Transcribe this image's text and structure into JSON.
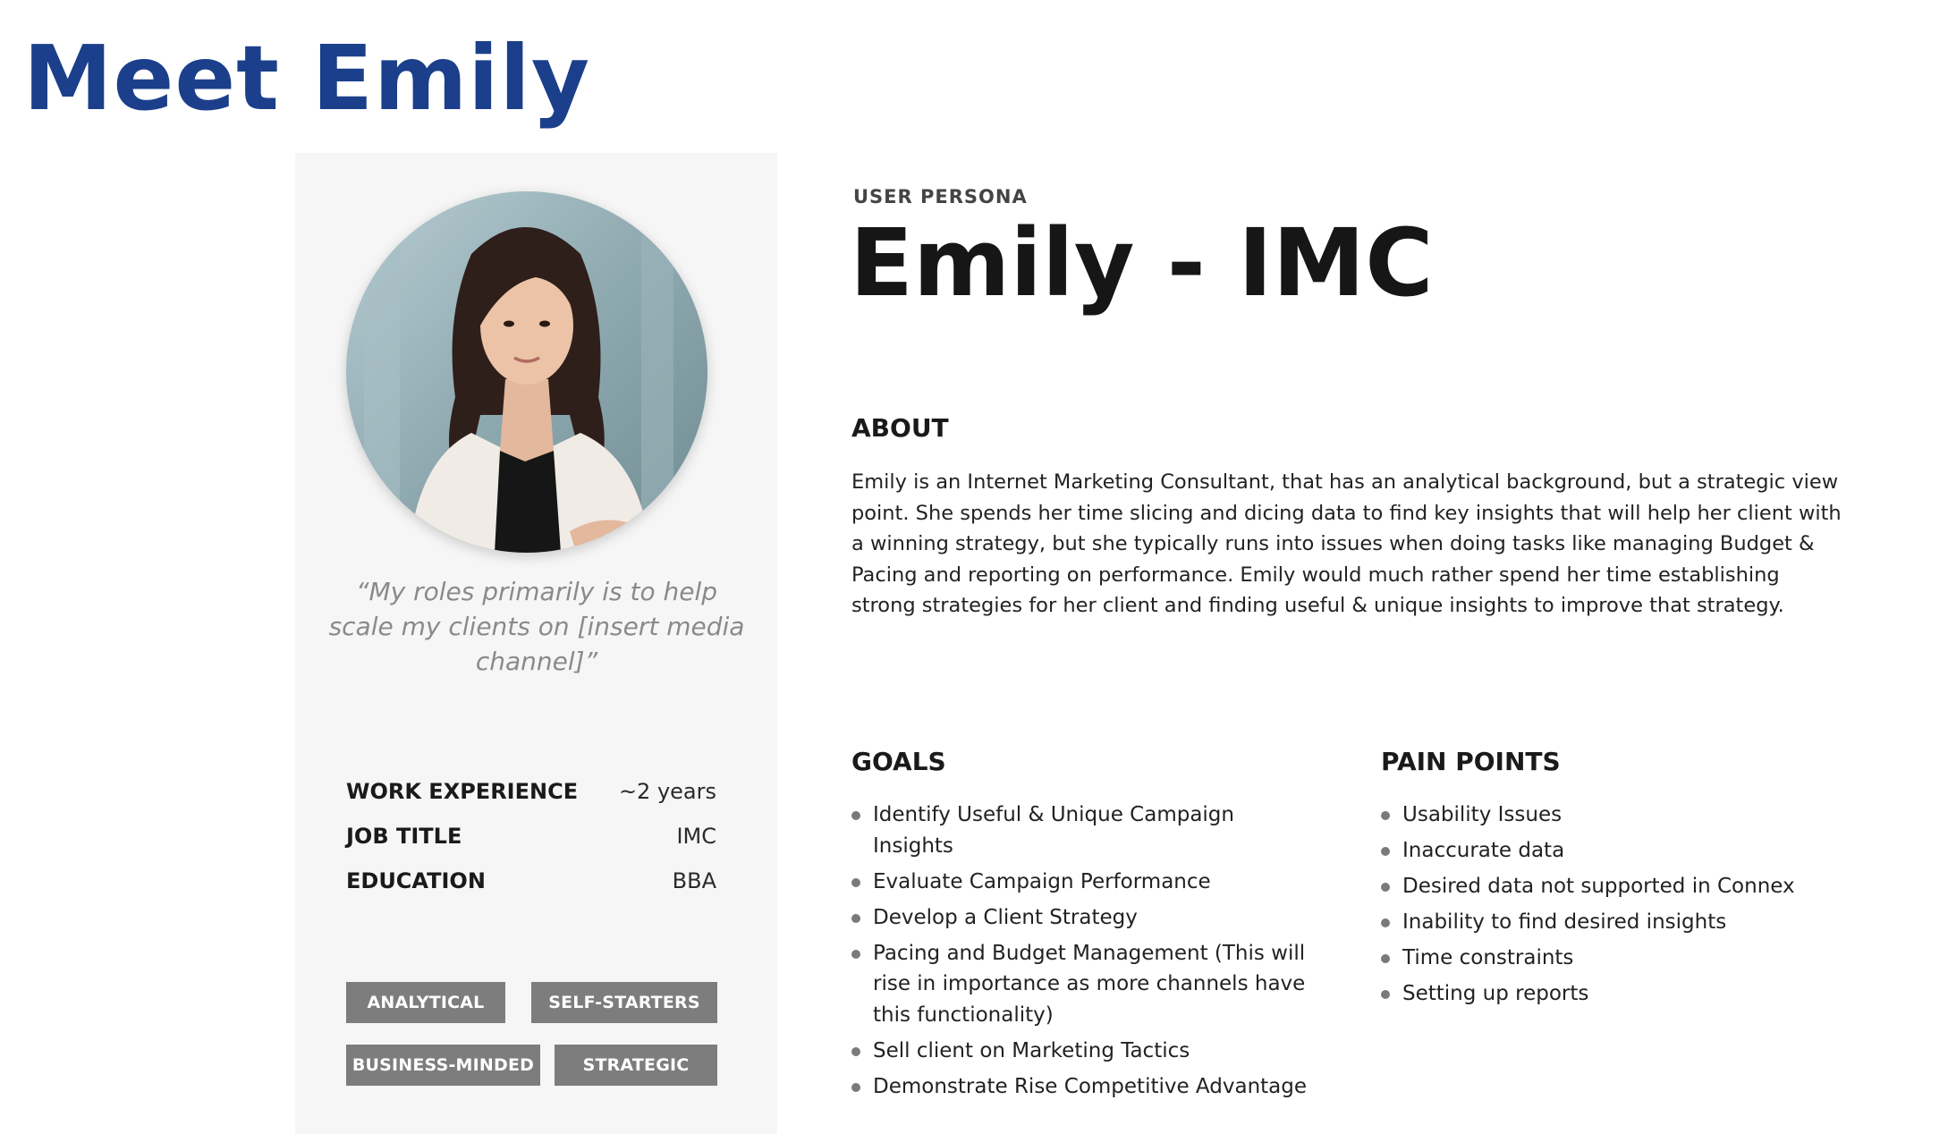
{
  "slide": {
    "title": "Meet Emily"
  },
  "profile": {
    "quote": "“My roles primarily is to help scale my clients on [insert media channel]”",
    "facts": [
      {
        "label": "WORK EXPERIENCE",
        "value": "~2 years"
      },
      {
        "label": "JOB TITLE",
        "value": "IMC"
      },
      {
        "label": "EDUCATION",
        "value": "BBA"
      }
    ],
    "tags": [
      "ANALYTICAL",
      "SELF-STARTERS",
      "BUSINESS-MINDED",
      "STRATEGIC"
    ],
    "tag_color": "#7d7d7d"
  },
  "persona": {
    "kicker": "USER PERSONA",
    "name": "Emily - IMC"
  },
  "about": {
    "heading": "ABOUT",
    "text": "Emily is an Internet Marketing Consultant, that has an analytical background, but a strategic view point. She spends her time slicing and dicing data to find key insights that will help her client with a winning strategy, but she typically runs into issues when doing tasks like managing Budget & Pacing and reporting on performance. Emily would much rather spend her time establishing strong strategies for her client and finding useful & unique insights to improve that strategy."
  },
  "goals": {
    "heading": "GOALS",
    "items": [
      "Identify Useful & Unique Campaign Insights",
      "Evaluate Campaign Performance",
      "Develop a Client Strategy",
      "Pacing and Budget Management (This will rise in importance as more channels have this functionality)",
      "Sell client on Marketing Tactics",
      "Demonstrate Rise Competitive Advantage"
    ]
  },
  "pain_points": {
    "heading": "PAIN POINTS",
    "items": [
      "Usability Issues",
      "Inaccurate data",
      "Desired data not supported in Connex",
      "Inability to find desired insights",
      "Time constraints",
      "Setting up reports"
    ]
  },
  "colors": {
    "title_blue": "#1b3f8b",
    "card_background": "#f6f6f6",
    "bullet": "#7a7a7a"
  }
}
